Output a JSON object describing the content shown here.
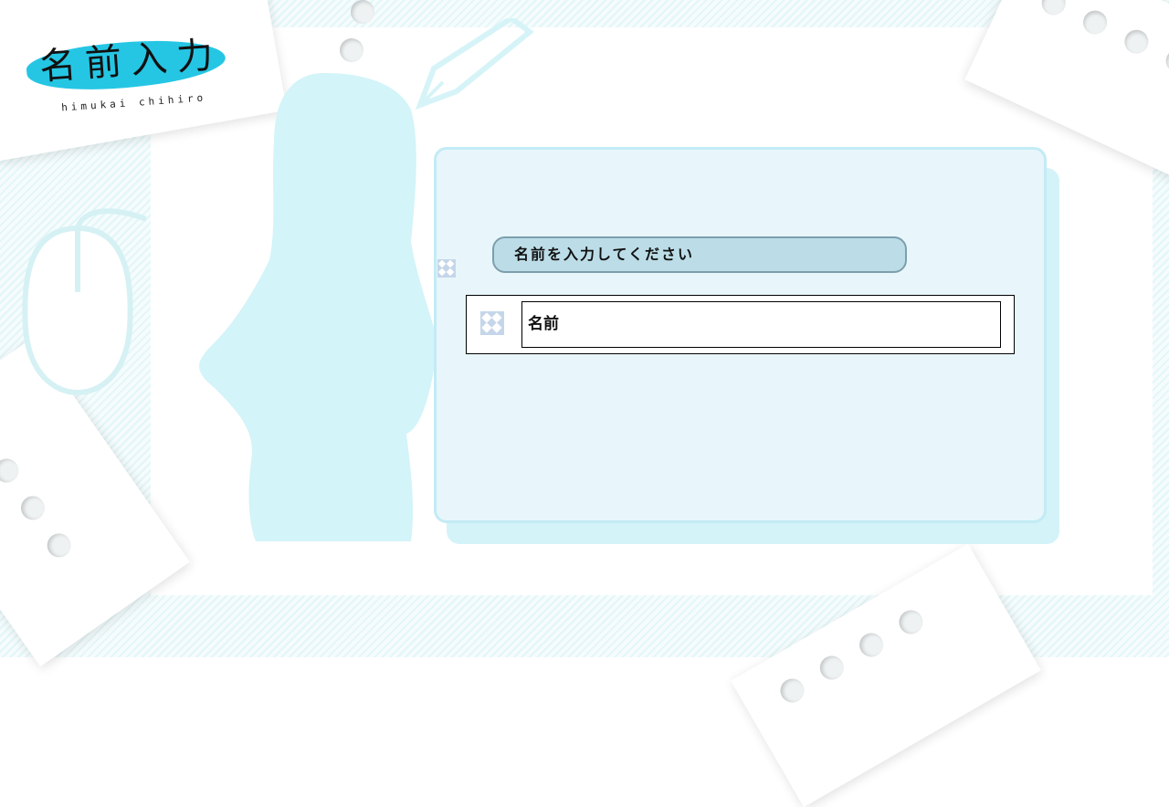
{
  "screen": {
    "title": "名前入力",
    "subtitle": "himukai chihiro"
  },
  "dialog": {
    "prompt": "名前を入力してください",
    "name_value": "名前"
  },
  "icons": {
    "broken_image_small": "broken-image-icon",
    "broken_image_row": "broken-image-icon"
  },
  "colors": {
    "accent": "#25c6e4",
    "panel_bg": "#e8f6fb",
    "prompt_bg": "#bcdde7",
    "silhouette": "#d3f4f8"
  }
}
